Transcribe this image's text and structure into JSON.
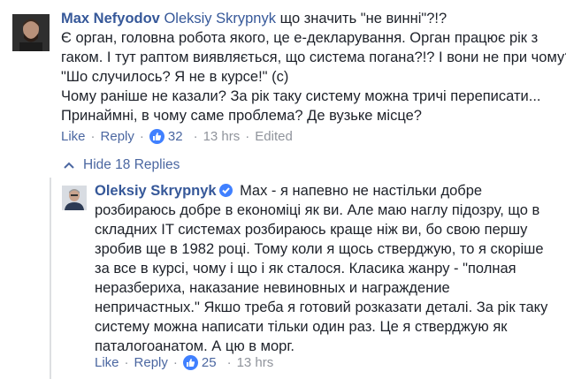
{
  "comment1": {
    "author": "Max Nefyodov",
    "mention": "Oleksiy Skrypnyk",
    "first_line_rest": " що значить \"не винні\"?!?",
    "lines": [
      "Є орган, головна робота якого, це е-декларування. Орган працює рік з",
      "гаком. І тут раптом виявляється, що система погана?!? І вони не при чому?",
      "\"Шо случилось? Я не в курсе!\" (с)",
      "Чому раніше не казали? За рік таку систему можна тричі переписати...",
      "Принаймні, в чому саме проблема? Де вузьке місце?"
    ],
    "like_label": "Like",
    "reply_label": "Reply",
    "reaction_count": "32",
    "time": "13 hrs",
    "edited": "Edited"
  },
  "replies_toggle": {
    "label": "Hide 18 Replies"
  },
  "comment2": {
    "author": "Oleksiy Skrypnyk",
    "first_line_rest": " Max - я напевно не настільки добре",
    "lines": [
      "розбираюсь добре в економіці як ви. Але маю наглу підозру, що в",
      "складних IT системах розбираюсь краще ніж ви, бо свою першу",
      "зробив ще в 1982 році. Тому коли я щось стверджую, то я скоріше",
      "за все в курсі, чому і що і як сталося. Класика жанру - \"полная",
      "неразбериха, наказание невиновных и награждение",
      "непричастных.\" Якшо треба я готовий розказати деталі. За рік таку",
      "систему можна написати тільки один раз. Це я стверджую як",
      "паталогоанатом. А цю в морг."
    ],
    "like_label": "Like",
    "reply_label": "Reply",
    "reaction_count": "25",
    "time": "13 hrs"
  },
  "colors": {
    "link": "#365899",
    "action": "#4b67a1",
    "meta": "#90949c",
    "like_badge": "#4080ff"
  }
}
